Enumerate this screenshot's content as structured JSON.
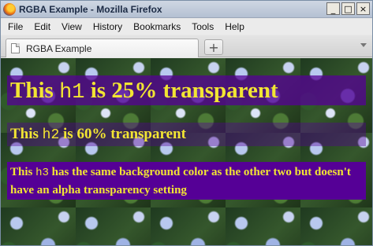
{
  "window": {
    "title": "RGBA Example - Mozilla Firefox",
    "buttons": {
      "minimize": "_",
      "maximize": "□",
      "close": "×"
    }
  },
  "menu": {
    "items": [
      "File",
      "Edit",
      "View",
      "History",
      "Bookmarks",
      "Tools",
      "Help"
    ]
  },
  "tabs": {
    "active_label": "RGBA Example",
    "new_tab_symbol": "+"
  },
  "content": {
    "h1": {
      "before": "This ",
      "code": "h1",
      "after": " is 25% transparent"
    },
    "h2": {
      "before": "This ",
      "code": "h2",
      "after": " is 60% transparent"
    },
    "h3": {
      "before": "This ",
      "code": "h3",
      "after": " has the same background color as the other two but doesn't have an alpha transparency setting"
    },
    "heading_bg_color": "#550096",
    "heading_text_color": "#f2e533"
  }
}
